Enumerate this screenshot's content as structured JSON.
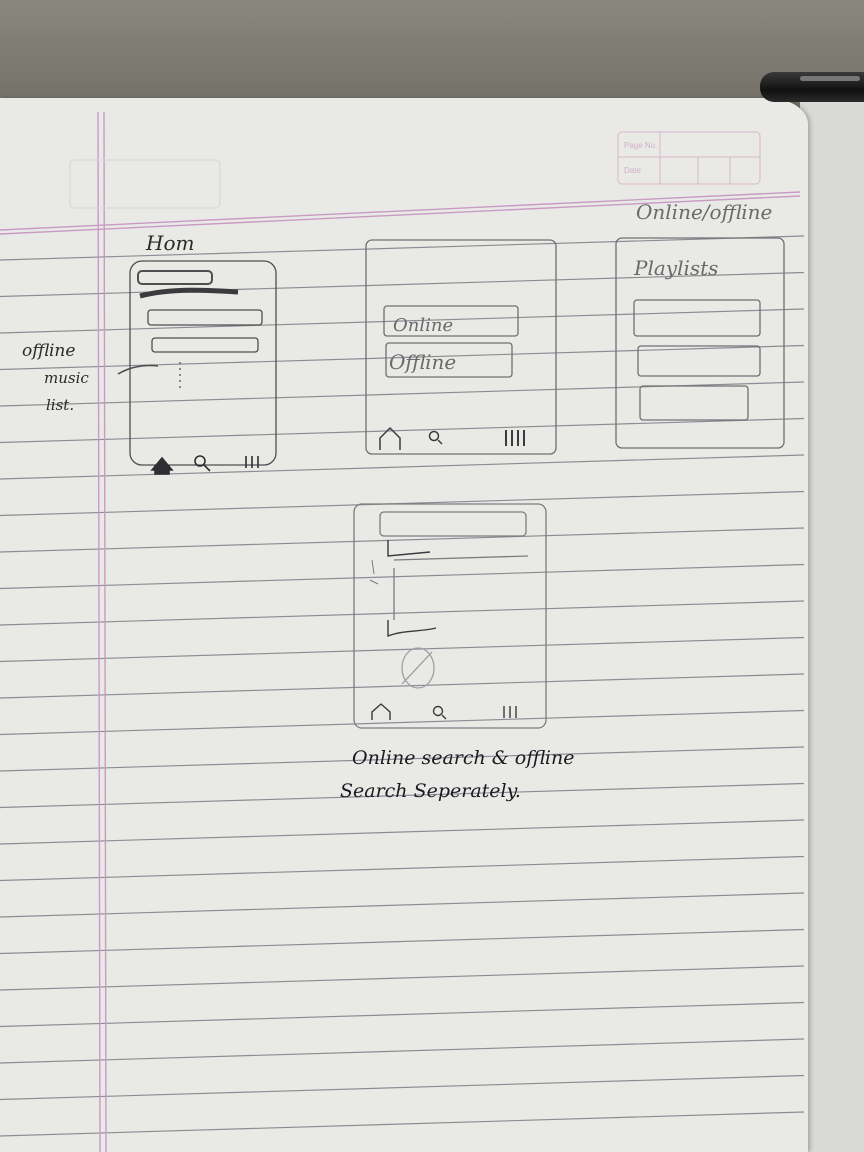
{
  "header_box": {
    "page_no_label": "Page No.",
    "date_label": "Date"
  },
  "sketch_home": {
    "title": "Hom",
    "side_note_lines": [
      "offline",
      "music",
      "list."
    ],
    "nav_icons": [
      "home-icon",
      "search-icon",
      "menu-bars-icon"
    ]
  },
  "sketch_mode": {
    "options": [
      "Online",
      "Offline"
    ],
    "nav_icons": [
      "home-icon",
      "search-icon",
      "menu-bars-icon"
    ]
  },
  "sketch_playlists": {
    "caption": "Online/offline",
    "title": "Playlists"
  },
  "sketch_search": {
    "nav_icons": [
      "home-icon",
      "search-icon",
      "menu-bars-icon"
    ],
    "caption_lines": [
      "Online search & offline",
      "Search Seperately."
    ]
  },
  "colors": {
    "paper": "#e9eae6",
    "rule_line": "#8a8d94",
    "margin_line": "#c99ac6",
    "pencil": "#6a6a6a",
    "ink": "#1b1a22"
  }
}
